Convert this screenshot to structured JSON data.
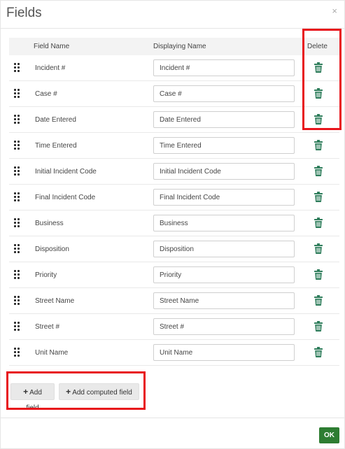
{
  "dialog": {
    "title": "Fields",
    "close_glyph": "×"
  },
  "table": {
    "headers": {
      "field_name": "Field Name",
      "displaying_name": "Displaying Name",
      "delete": "Delete"
    },
    "rows": [
      {
        "field_name": "Incident #",
        "display_value": "Incident #"
      },
      {
        "field_name": "Case #",
        "display_value": "Case #"
      },
      {
        "field_name": "Date Entered",
        "display_value": "Date Entered"
      },
      {
        "field_name": "Time Entered",
        "display_value": "Time Entered"
      },
      {
        "field_name": "Initial Incident Code",
        "display_value": "Initial Incident Code"
      },
      {
        "field_name": "Final Incident Code",
        "display_value": "Final Incident Code"
      },
      {
        "field_name": "Business",
        "display_value": "Business"
      },
      {
        "field_name": "Disposition",
        "display_value": "Disposition"
      },
      {
        "field_name": "Priority",
        "display_value": "Priority"
      },
      {
        "field_name": "Street Name",
        "display_value": "Street Name"
      },
      {
        "field_name": "Street #",
        "display_value": "Street #"
      },
      {
        "field_name": "Unit Name",
        "display_value": "Unit Name"
      }
    ]
  },
  "buttons": {
    "add_field": "Add field",
    "add_computed_field": "Add computed field",
    "plus_glyph": "+",
    "ok": "OK"
  },
  "icons": {
    "row_handle": "drag-handle-icon",
    "row_delete": "trash-icon"
  },
  "colors": {
    "trash": "#2e7d5b",
    "highlight": "#e8141b",
    "ok_button": "#2e7d32"
  }
}
